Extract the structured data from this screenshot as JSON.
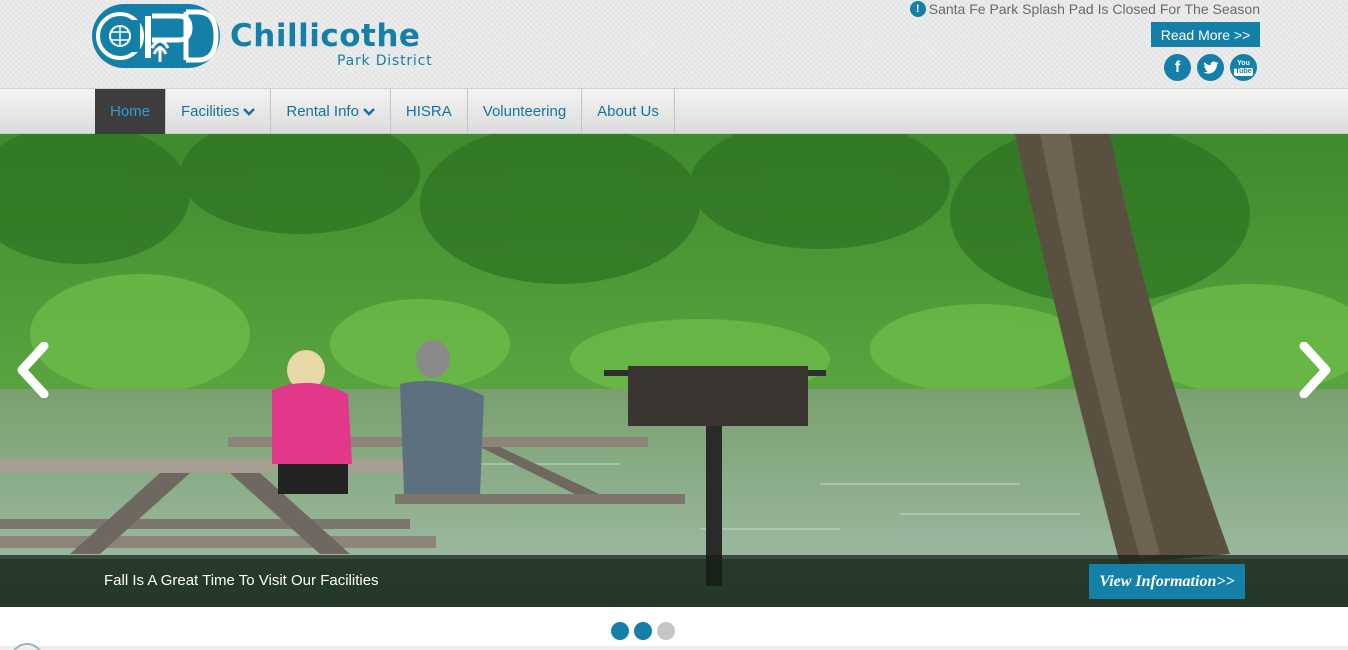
{
  "site": {
    "logo_monogram": "CPD",
    "logo_name": "Chillicothe",
    "logo_subtitle": "Park District"
  },
  "alert": {
    "icon": "alert-icon",
    "icon_glyph": "!",
    "text": "Santa Fe Park Splash Pad Is Closed For The Season",
    "read_more_label": "Read More >>"
  },
  "social": {
    "facebook_icon": "f",
    "twitter_icon": "twitter",
    "youtube_icon_top": "You",
    "youtube_icon_bottom": "Tube"
  },
  "nav": {
    "items": [
      {
        "label": "Home",
        "active": true,
        "has_dropdown": false
      },
      {
        "label": "Facilities",
        "active": false,
        "has_dropdown": true
      },
      {
        "label": "Rental Info",
        "active": false,
        "has_dropdown": true
      },
      {
        "label": "HISRA",
        "active": false,
        "has_dropdown": false
      },
      {
        "label": "Volunteering",
        "active": false,
        "has_dropdown": false
      },
      {
        "label": "About Us",
        "active": false,
        "has_dropdown": false
      }
    ]
  },
  "slider": {
    "caption": "Fall Is A Great Time To Visit Our Facilities",
    "cta_label": "View Information>>",
    "slide_count": 3,
    "active_slide": 1
  },
  "colors": {
    "brand_blue": "#1480a8",
    "nav_active_bg": "#3d3d3d",
    "dot_inactive": "#c6c6c6"
  }
}
